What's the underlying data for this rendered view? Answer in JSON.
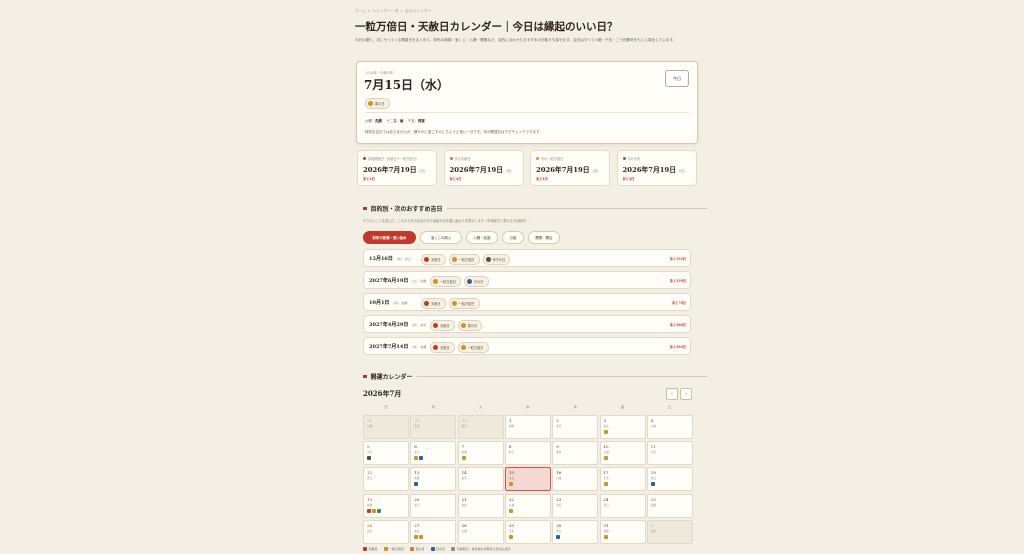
{
  "breadcrumb": "ホーム > カレンダー一覧 > 吉日カレンダー",
  "page_title": "一粒万倍日・天赦日カレンダー｜今日は縁起のいい日？",
  "lead": "今日の暦と、次にやってくる開運日をまとめて。財布の新調・宝くじ・入籍・開業など、目的に合わせたおすすめの日取りも探せます。吉日はすべて六曜・干支・二十四節気をもとに算出しています。",
  "today": {
    "label": "2026年（令和8年）",
    "date": "7月15日（水）",
    "button": "今日",
    "chip": "寅の日",
    "meta": [
      {
        "k": "六曜",
        "v": "先勝"
      },
      {
        "k": "十二直",
        "v": "破"
      },
      {
        "k": "干支",
        "v": "丙寅"
      }
    ],
    "desc": "特別な吉日ではありませんが、穏やかに過ごすのにちょうど良い一日です。次の開運日は下でチェックできます。"
  },
  "next": [
    {
      "label": "最強開運日（天赦日＋一粒万倍日）",
      "date": "2026年7月19日",
      "wd": "（日）",
      "rest": "あと4日",
      "color": "#c0392b"
    },
    {
      "label": "次の天赦日",
      "date": "2026年7月19日",
      "wd": "（日）",
      "rest": "あと4日",
      "color": "#d4753b"
    },
    {
      "label": "次の一粒万倍日",
      "date": "2026年7月19日",
      "wd": "（日）",
      "rest": "あと4日",
      "color": "#c9962c"
    },
    {
      "label": "次の大安",
      "date": "2026年7月19日",
      "wd": "（日）",
      "rest": "あと4日",
      "color": "#3b8c5a"
    }
  ],
  "section1": {
    "title": "目的別・次のおすすめ吉日",
    "sub": "やりたいことを選ぶと、これから先の吉日の中で最適な日を順に最大５件表示します（不成就日と重なる日は除外）。",
    "tabs": [
      "財布の新調・使い始め",
      "宝くじの購入",
      "入籍・結婚",
      "引越",
      "開業・開店"
    ],
    "rows": [
      {
        "date": "12月16日",
        "wd": "（水）",
        "rk": "赤口",
        "chips": [
          [
            "天赦日",
            "#c0392b"
          ],
          [
            "一粒万倍日",
            "#c9962c"
          ],
          [
            "甲子の日",
            "#5a4c3e"
          ]
        ],
        "rest": "あと154日"
      },
      {
        "date": "2027年6月19日",
        "wd": "（土）",
        "rk": "先勝",
        "chips": [
          [
            "一粒万倍日",
            "#c9962c"
          ],
          [
            "巳の日",
            "#2f5f9e"
          ]
        ],
        "rest": "あと339日"
      },
      {
        "date": "10月1日",
        "wd": "（木）",
        "rk": "先勝",
        "chips": [
          [
            "天赦日",
            "#c0392b"
          ],
          [
            "一粒万倍日",
            "#c9962c"
          ]
        ],
        "rest": "あと78日"
      },
      {
        "date": "2027年4月29日",
        "wd": "（木）",
        "rk": "友引",
        "chips": [
          [
            "天赦日",
            "#c0392b"
          ],
          [
            "寅の日",
            "#c9962c"
          ]
        ],
        "rest": "あと288日"
      },
      {
        "date": "2027年7月14日",
        "wd": "（水）",
        "rk": "先勝",
        "chips": [
          [
            "天赦日",
            "#c0392b"
          ],
          [
            "一粒万倍日",
            "#c9962c"
          ]
        ],
        "rest": "あと364日"
      }
    ]
  },
  "section2": {
    "title": "開運カレンダー",
    "month": "2026年7月",
    "prev": "‹",
    "next": "›",
    "weekdays": [
      "日",
      "月",
      "火",
      "水",
      "木",
      "金",
      "土"
    ],
    "days": [
      {
        "n": "28",
        "r": "仏滅",
        "out": true
      },
      {
        "n": "29",
        "r": "大安",
        "out": true
      },
      {
        "n": "30",
        "r": "赤口",
        "out": true
      },
      {
        "n": "1",
        "r": "先勝"
      },
      {
        "n": "2",
        "r": "友引"
      },
      {
        "n": "3",
        "r": "先負",
        "b": [
          "#c9962c"
        ]
      },
      {
        "n": "4",
        "r": "仏滅"
      },
      {
        "n": "5",
        "r": "大安",
        "b": [
          "#5a4c3e"
        ]
      },
      {
        "n": "6",
        "r": "赤口",
        "b": [
          "#c9962c",
          "#2f5f9e"
        ]
      },
      {
        "n": "7",
        "r": "先勝",
        "b": [
          "#c9962c"
        ]
      },
      {
        "n": "8",
        "r": "友引"
      },
      {
        "n": "9",
        "r": "先負"
      },
      {
        "n": "10",
        "r": "仏滅",
        "b": [
          "#c9962c"
        ]
      },
      {
        "n": "11",
        "r": "大安"
      },
      {
        "n": "12",
        "r": "赤口"
      },
      {
        "n": "13",
        "r": "先勝",
        "b": [
          "#2f5f9e"
        ]
      },
      {
        "n": "14",
        "r": "友引"
      },
      {
        "n": "15",
        "r": "先負",
        "b": [
          "#c9962c"
        ],
        "today": true
      },
      {
        "n": "16",
        "r": "仏滅"
      },
      {
        "n": "17",
        "r": "大安",
        "b": [
          "#c9962c"
        ]
      },
      {
        "n": "18",
        "r": "赤口",
        "b": [
          "#2f5f9e"
        ]
      },
      {
        "n": "19",
        "r": "先勝",
        "b": [
          "#c0392b",
          "#c9962c",
          "#3b8c5a"
        ]
      },
      {
        "n": "20",
        "r": "友引"
      },
      {
        "n": "21",
        "r": "先負"
      },
      {
        "n": "22",
        "r": "仏滅",
        "b": [
          "#c9962c"
        ]
      },
      {
        "n": "23",
        "r": "大安"
      },
      {
        "n": "24",
        "r": "赤口"
      },
      {
        "n": "25",
        "r": "先勝"
      },
      {
        "n": "26",
        "r": "友引"
      },
      {
        "n": "27",
        "r": "先負",
        "b": [
          "#c9962c",
          "#c9962c"
        ]
      },
      {
        "n": "28",
        "r": "仏滅"
      },
      {
        "n": "29",
        "r": "大安",
        "b": [
          "#c9962c"
        ]
      },
      {
        "n": "30",
        "r": "赤口",
        "b": [
          "#2f5f9e"
        ]
      },
      {
        "n": "31",
        "r": "先勝",
        "b": [
          "#c9962c"
        ]
      },
      {
        "n": "1",
        "r": "友引",
        "out": true
      }
    ]
  },
  "legend": [
    {
      "t": "天赦日",
      "c": "#c0392b"
    },
    {
      "t": "一粒万倍日",
      "c": "#c9962c"
    },
    {
      "t": "寅の日",
      "c": "#d4753b"
    },
    {
      "t": "巳の日",
      "c": "#2f5f9e"
    },
    {
      "t": "不成就日：吉日効力が弱まる日付も表示",
      "c": "#9a8c79"
    }
  ]
}
